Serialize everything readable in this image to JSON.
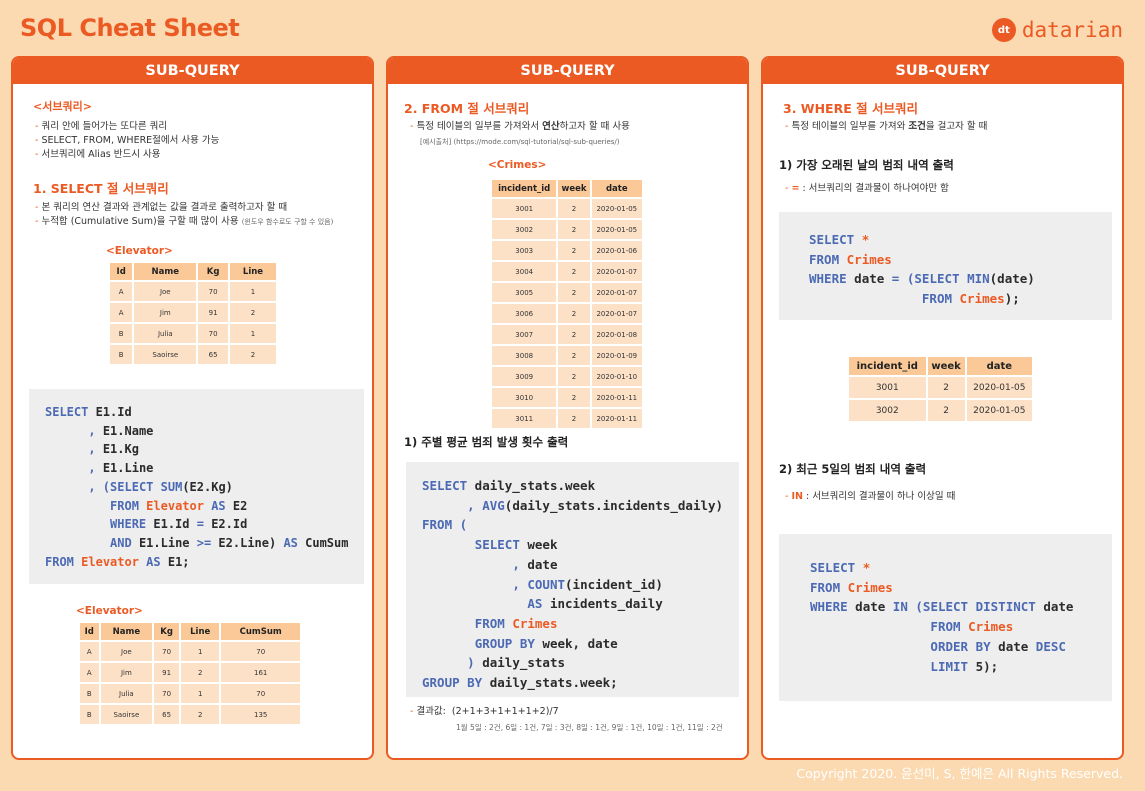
{
  "header": {
    "title": "SQL Cheat Sheet",
    "brand_logo": "dt",
    "brand_name": "datarian"
  },
  "footer": {
    "copyright": "Copyright 2020. 윤선미, S, 한예은 All Rights Reserved."
  },
  "colors": {
    "accent": "#ec5a24",
    "background": "#fbd9b1",
    "table_header": "#fbc998",
    "table_cell": "#fde1c7",
    "code_bg": "#eeeeee",
    "keyword": "#4c6ab4"
  },
  "col1": {
    "header": "SUB-QUERY",
    "intro_title": "<서브쿼리>",
    "intro_bullets": [
      "쿼리 안에 들어가는 또다른 쿼리",
      "SELECT, FROM, WHERE절에서 사용 가능",
      "서브쿼리에 Alias 반드시 사용"
    ],
    "section_title": "1. SELECT 절 서브쿼리",
    "section_bullets": [
      "본 쿼리의 연산 결과와 관계없는 값을 결과로 출력하고자 할 때",
      "누적합 (Cumulative Sum)을 구할 때 많이 사용"
    ],
    "section_note": "(윈도우 함수로도 구할 수 있음)",
    "table1": {
      "caption": "<Elevator>",
      "columns": [
        "Id",
        "Name",
        "Kg",
        "Line"
      ],
      "rows": [
        [
          "A",
          "Joe",
          "70",
          "1"
        ],
        [
          "A",
          "Jim",
          "91",
          "2"
        ],
        [
          "B",
          "Julia",
          "70",
          "1"
        ],
        [
          "B",
          "Saoirse",
          "65",
          "2"
        ]
      ]
    },
    "code": [
      [
        "SELECT",
        " E1.Id"
      ],
      [
        "      ,",
        " E1.Name"
      ],
      [
        "      ,",
        " E1.Kg"
      ],
      [
        "      ,",
        " E1.Line"
      ],
      [
        "      , (SELECT SUM",
        "(E2.Kg)"
      ],
      [
        "         FROM ",
        "Elevator",
        " AS",
        " E2"
      ],
      [
        "         WHERE",
        " E1.Id ",
        "=",
        " E2.Id"
      ],
      [
        "         AND",
        " E1.Line ",
        ">=",
        " E2.Line) ",
        "AS",
        " CumSum"
      ],
      [
        "FROM ",
        "Elevator",
        " AS",
        " E1;"
      ]
    ],
    "table2": {
      "caption": "<Elevator>",
      "columns": [
        "Id",
        "Name",
        "Kg",
        "Line",
        "CumSum"
      ],
      "rows": [
        [
          "A",
          "Joe",
          "70",
          "1",
          "70"
        ],
        [
          "A",
          "Jim",
          "91",
          "2",
          "161"
        ],
        [
          "B",
          "Julia",
          "70",
          "1",
          "70"
        ],
        [
          "B",
          "Saoirse",
          "65",
          "2",
          "135"
        ]
      ]
    }
  },
  "col2": {
    "header": "SUB-QUERY",
    "section_title": "2. FROM 절 서브쿼리",
    "bullet_pre": "특정 테이블의 일부를 가져와서 ",
    "bullet_bold": "연산",
    "bullet_post": "하고자 할 때 사용",
    "source": "[예시출처] (https://mode.com/sql-tutorial/sql-sub-queries/)",
    "table": {
      "caption": "<Crimes>",
      "columns": [
        "incident_id",
        "week",
        "date"
      ],
      "rows": [
        [
          "3001",
          "2",
          "2020-01-05"
        ],
        [
          "3002",
          "2",
          "2020-01-05"
        ],
        [
          "3003",
          "2",
          "2020-01-06"
        ],
        [
          "3004",
          "2",
          "2020-01-07"
        ],
        [
          "3005",
          "2",
          "2020-01-07"
        ],
        [
          "3006",
          "2",
          "2020-01-07"
        ],
        [
          "3007",
          "2",
          "2020-01-08"
        ],
        [
          "3008",
          "2",
          "2020-01-09"
        ],
        [
          "3009",
          "2",
          "2020-01-10"
        ],
        [
          "3010",
          "2",
          "2020-01-11"
        ],
        [
          "3011",
          "2",
          "2020-01-11"
        ]
      ]
    },
    "sub_title": "1) 주별 평균 범죄 발생 횟수 출력",
    "result_label": "결과값:",
    "result_formula": "(2+1+3+1+1+1+2)/7",
    "result_detail": "1월 5일 : 2건, 6일 : 1건, 7일 : 3건, 8일 : 1건, 9일 : 1건, 10일 : 1건, 11일 : 2건"
  },
  "col3": {
    "header": "SUB-QUERY",
    "section_title": "3. WHERE 절 서브쿼리",
    "bullet_pre": "특정 테이블의 일부를 가져와 ",
    "bullet_bold": "조건",
    "bullet_post": "을 걸고자 할 때",
    "sub1_title": "1) 가장 오래된 날의 범죄 내역 출력",
    "sub1_op": "=",
    "sub1_desc": " : 서브쿼리의 결과물이 하나여야만 함",
    "table": {
      "columns": [
        "incident_id",
        "week",
        "date"
      ],
      "rows": [
        [
          "3001",
          "2",
          "2020-01-05"
        ],
        [
          "3002",
          "2",
          "2020-01-05"
        ]
      ]
    },
    "sub2_title": "2) 최근 5일의 범죄 내역 출력",
    "sub2_op": "IN",
    "sub2_desc": " : 서브쿼리의 결과물이 하나 이상일 때"
  },
  "code_tokens": {
    "select": "SELECT",
    "from": "FROM",
    "where": "WHERE",
    "as": "AS",
    "and": "AND",
    "group_by": "GROUP BY",
    "order_by": "ORDER BY",
    "limit": "LIMIT",
    "in": "IN",
    "distinct": "DISTINCT",
    "desc": "DESC",
    "min": "MIN",
    "avg": "AVG",
    "count": "COUNT",
    "sum": "SUM",
    "star": "*",
    "crimes": "Crimes",
    "elevator": "Elevator"
  }
}
